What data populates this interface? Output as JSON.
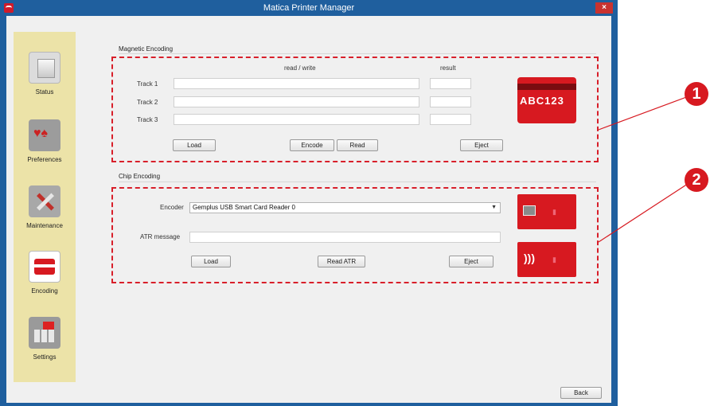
{
  "window": {
    "title": "Matica Printer Manager",
    "close_label": "×"
  },
  "sidebar": {
    "items": [
      {
        "label": "Status",
        "icon": "printer-icon"
      },
      {
        "label": "Preferences",
        "icon": "cards-icon"
      },
      {
        "label": "Maintenance",
        "icon": "tools-icon"
      },
      {
        "label": "Encoding",
        "icon": "card-icon"
      },
      {
        "label": "Settings",
        "icon": "settings-icon"
      }
    ]
  },
  "magnetic": {
    "title": "Magnetic Encoding",
    "col_readwrite": "read / write",
    "col_result": "result",
    "tracks": [
      {
        "label": "Track 1",
        "value": "",
        "result": ""
      },
      {
        "label": "Track 2",
        "value": "",
        "result": ""
      },
      {
        "label": "Track 3",
        "value": "",
        "result": ""
      }
    ],
    "buttons": {
      "load": "Load",
      "encode": "Encode",
      "read": "Read",
      "eject": "Eject"
    },
    "tile_letters": "ABC123"
  },
  "chip": {
    "title": "Chip Encoding",
    "encoder_label": "Encoder",
    "encoder_value": "Gemplus USB Smart Card Reader 0",
    "atr_label": "ATR message",
    "atr_value": "",
    "buttons": {
      "load": "Load",
      "read_atr": "Read ATR",
      "eject": "Eject"
    }
  },
  "footer": {
    "back": "Back"
  },
  "callouts": [
    "1",
    "2"
  ],
  "colors": {
    "accent": "#d71920",
    "titlebar": "#1f5f9e",
    "sidebar": "#ece3a8"
  }
}
